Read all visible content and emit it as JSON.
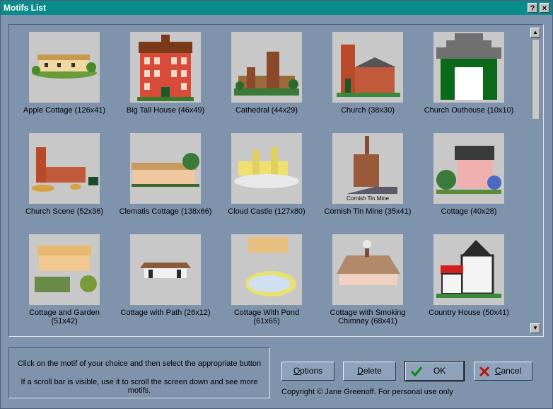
{
  "window": {
    "title": "Motifs List",
    "help_label": "?",
    "close_label": "×"
  },
  "motifs": [
    "Apple Cottage (126x41)",
    "Big Tall House (46x49)",
    "Cathedral (44x29)",
    "Church (38x30)",
    "Church Outhouse (10x10)",
    "Church Scene (52x36)",
    "Clematis Cottage (138x66)",
    "Cloud Castle (127x80)",
    "Cornish Tin Mine (35x41)",
    "Cottage (40x28)",
    "Cottage and Garden (51x42)",
    "Cottage with Path (26x12)",
    "Cottage With Pond (61x65)",
    "Cottage with Smoking Chimney (68x41)",
    "Country House (50x41)"
  ],
  "mine_caption": "Cornish Tin Mine",
  "info": {
    "line1": "Click on the motif of your choice and then select the appropriate button",
    "line2": "If a scroll bar is visible, use it to scroll the screen down and see more motifs."
  },
  "buttons": {
    "options_u": "O",
    "options_rest": "ptions",
    "delete_u": "D",
    "delete_rest": "elete",
    "ok": "OK",
    "cancel_u": "C",
    "cancel_rest": "ancel"
  },
  "copyright": "Copyright © Jane Greenoff. For personal use only"
}
